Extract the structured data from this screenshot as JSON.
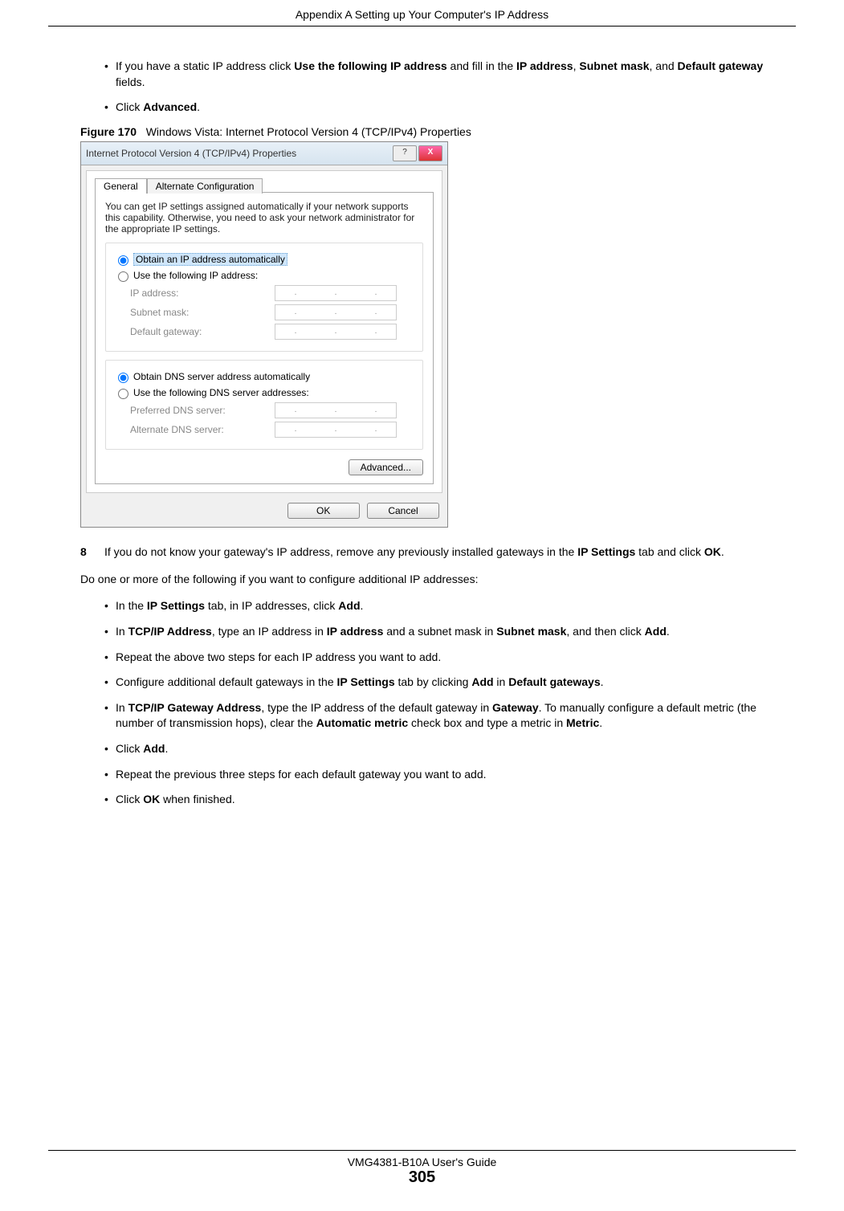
{
  "header": "Appendix A Setting up Your Computer's IP Address",
  "bullets_top": [
    {
      "pre": "If you have a static IP address click ",
      "b1": "Use the following IP address",
      "mid1": " and fill in the ",
      "b2": "IP address",
      "mid2": ", ",
      "b3": "Subnet mask",
      "mid3": ", and ",
      "b4": "Default gateway",
      "post": " fields."
    },
    {
      "pre": "Click ",
      "b1": "Advanced",
      "post": "."
    }
  ],
  "figure": {
    "label": "Figure 170",
    "caption": "Windows Vista: Internet Protocol Version 4 (TCP/IPv4) Properties"
  },
  "dialog": {
    "title": "Internet Protocol Version 4 (TCP/IPv4) Properties",
    "tabs": {
      "general": "General",
      "alt": "Alternate Configuration"
    },
    "desc": "You can get IP settings assigned automatically if your network supports this capability. Otherwise, you need to ask your network administrator for the appropriate IP settings.",
    "radio_ip_auto": "Obtain an IP address automatically",
    "radio_ip_manual": "Use the following IP address:",
    "ip_label": "IP address:",
    "subnet_label": "Subnet mask:",
    "gateway_label": "Default gateway:",
    "radio_dns_auto": "Obtain DNS server address automatically",
    "radio_dns_manual": "Use the following DNS server addresses:",
    "pref_dns": "Preferred DNS server:",
    "alt_dns": "Alternate DNS server:",
    "advanced_btn": "Advanced...",
    "ok_btn": "OK",
    "cancel_btn": "Cancel"
  },
  "step8": {
    "num": "8",
    "pre": " If you do not know your gateway's IP address, remove any previously installed gateways in the ",
    "b1": "IP Settings",
    "mid": " tab and click ",
    "b2": "OK",
    "post": "."
  },
  "intertext": "Do one or more of the following if you want to configure additional IP addresses:",
  "bullets_bottom": [
    {
      "segments": [
        {
          "t": "In the "
        },
        {
          "t": "IP Settings",
          "b": true
        },
        {
          "t": " tab, in IP addresses, click "
        },
        {
          "t": "Add",
          "b": true
        },
        {
          "t": "."
        }
      ]
    },
    {
      "segments": [
        {
          "t": "In "
        },
        {
          "t": "TCP/IP Address",
          "b": true
        },
        {
          "t": ", type an IP address in "
        },
        {
          "t": "IP address",
          "b": true
        },
        {
          "t": " and a subnet mask in "
        },
        {
          "t": "Subnet mask",
          "b": true
        },
        {
          "t": ", and then click "
        },
        {
          "t": "Add",
          "b": true
        },
        {
          "t": "."
        }
      ]
    },
    {
      "segments": [
        {
          "t": "Repeat the above two steps for each IP address you want to add."
        }
      ]
    },
    {
      "segments": [
        {
          "t": "Configure additional default gateways in the "
        },
        {
          "t": "IP Settings",
          "b": true
        },
        {
          "t": " tab by clicking "
        },
        {
          "t": "Add",
          "b": true
        },
        {
          "t": " in "
        },
        {
          "t": "Default gateways",
          "b": true
        },
        {
          "t": "."
        }
      ]
    },
    {
      "segments": [
        {
          "t": "In "
        },
        {
          "t": "TCP/IP Gateway Address",
          "b": true
        },
        {
          "t": ", type the IP address of the default gateway in "
        },
        {
          "t": "Gateway",
          "b": true
        },
        {
          "t": ". To manually configure a default metric (the number of transmission hops), clear the "
        },
        {
          "t": "Automatic metric",
          "b": true
        },
        {
          "t": " check box and type a metric in "
        },
        {
          "t": "Metric",
          "b": true
        },
        {
          "t": "."
        }
      ]
    },
    {
      "segments": [
        {
          "t": "Click "
        },
        {
          "t": "Add",
          "b": true
        },
        {
          "t": "."
        }
      ]
    },
    {
      "segments": [
        {
          "t": "Repeat the previous three steps for each default gateway you want to add."
        }
      ]
    },
    {
      "segments": [
        {
          "t": "Click "
        },
        {
          "t": "OK",
          "b": true
        },
        {
          "t": " when finished."
        }
      ]
    }
  ],
  "footer": {
    "guide": "VMG4381-B10A User's Guide",
    "page": "305"
  }
}
